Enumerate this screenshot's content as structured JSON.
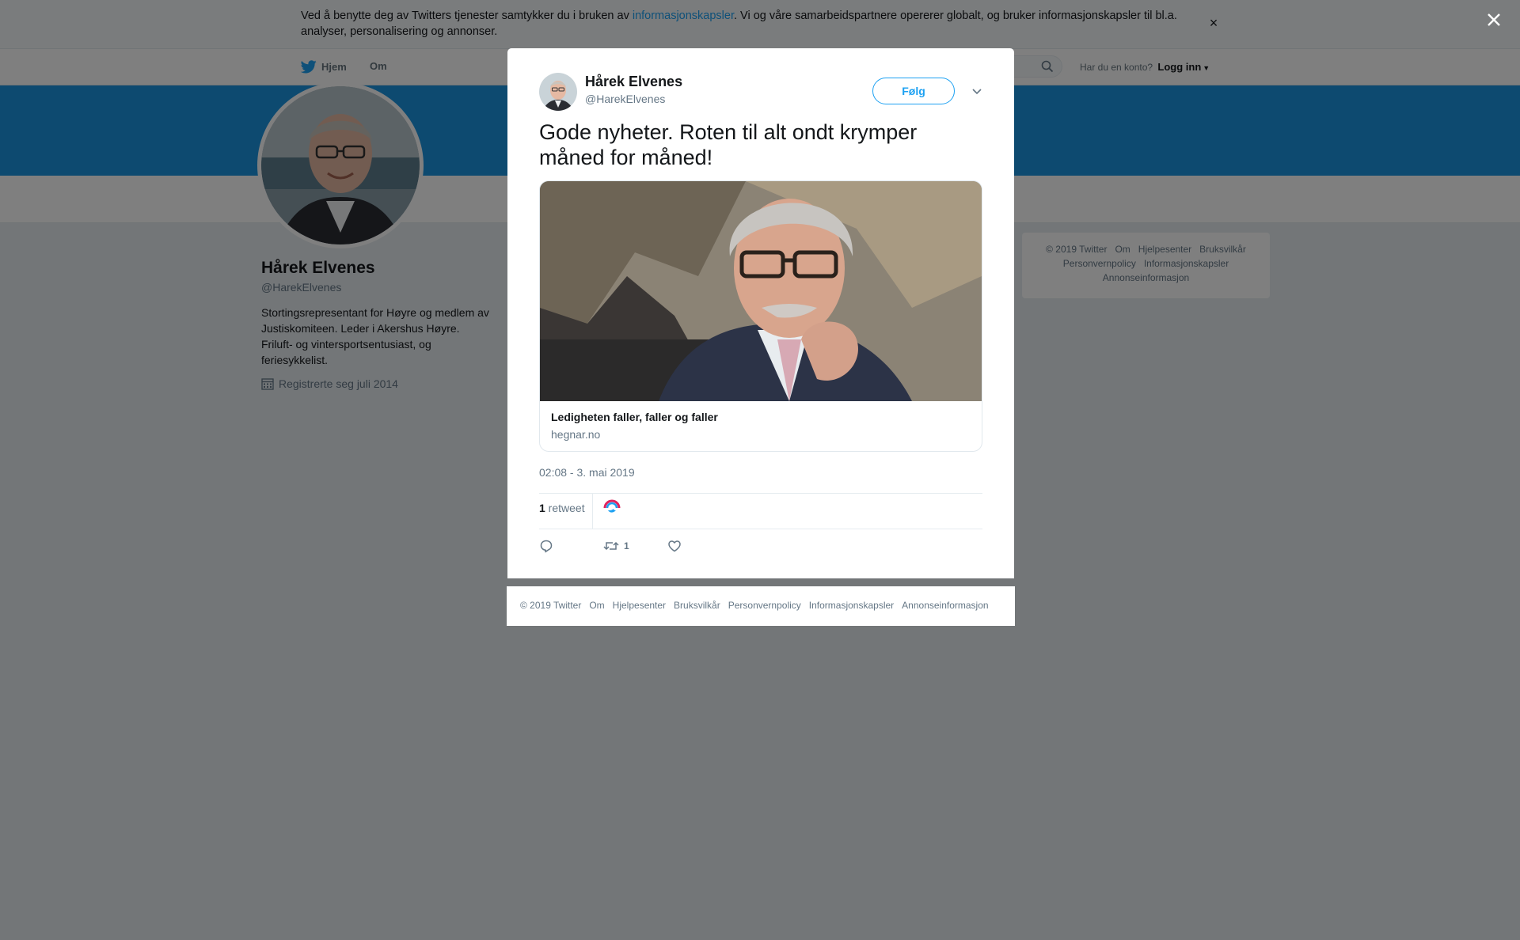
{
  "cookie_banner": {
    "text_before": "Ved å benytte deg av Twitters tjenester samtykker du i bruken av ",
    "link": "informasjonskapsler",
    "text_after": ". Vi og våre samarbeidspartnere opererer globalt, og bruker informasjonskapsler til bl.a. analyser, personalisering og annonser.",
    "close": "×"
  },
  "nav": {
    "home": "Hjem",
    "about": "Om",
    "login_prompt": "Har du en konto?",
    "login": "Logg inn"
  },
  "profile": {
    "name": "Hårek Elvenes",
    "handle": "@HarekElvenes",
    "bio": "Stortingsrepresentant for Høyre og medlem av Justiskomiteen. Leder i Akershus Høyre. Friluft- og vintersportsentusiast, og feriesykkelist.",
    "joined": "Registrerte seg juli 2014"
  },
  "tweet": {
    "author_name": "Hårek Elvenes",
    "author_handle": "@HarekElvenes",
    "follow": "Følg",
    "text": "Gode nyheter. Roten til alt ondt krymper måned for måned!",
    "card_title": "Ledigheten faller, faller og faller",
    "card_domain": "hegnar.no",
    "time": "02:08 - 3. mai 2019",
    "retweet_count": "1",
    "retweet_label": " retweet",
    "action_retweet_count": "1"
  },
  "footer": {
    "copyright": "© 2019 Twitter",
    "links": [
      "Om",
      "Hjelpesenter",
      "Bruksvilkår",
      "Personvernpolicy",
      "Informasjonskapsler",
      "Annonseinformasjon"
    ]
  },
  "colors": {
    "accent": "#1da1f2",
    "banner": "#1b95e0",
    "overlay": "rgba(0,0,0,0.5)"
  },
  "icons": [
    "twitter-bird-icon",
    "search-icon",
    "calendar-icon",
    "close-icon",
    "chevron-down-icon",
    "reply-icon",
    "retweet-icon",
    "like-icon"
  ]
}
